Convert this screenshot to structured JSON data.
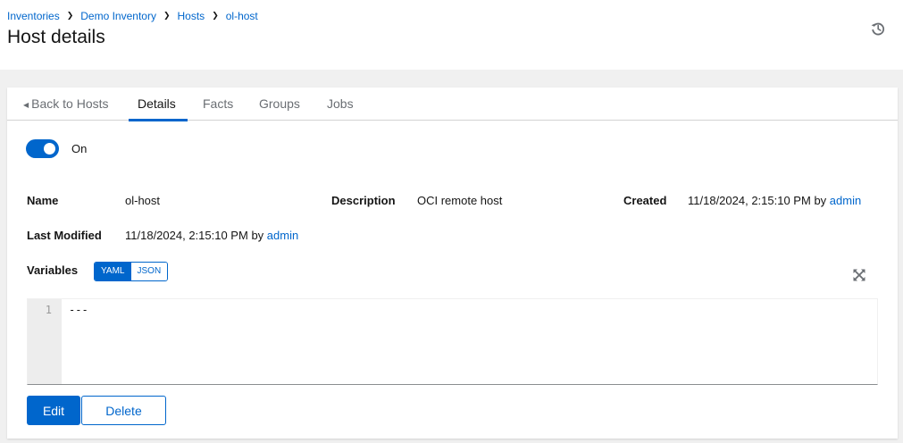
{
  "breadcrumb": [
    {
      "label": "Inventories"
    },
    {
      "label": "Demo Inventory"
    },
    {
      "label": "Hosts"
    },
    {
      "label": "ol-host"
    }
  ],
  "header": {
    "title": "Host details",
    "history_icon": "history-icon"
  },
  "tabs": [
    {
      "label": "Back to Hosts",
      "icon": "caret-left-icon"
    },
    {
      "label": "Details",
      "active": true
    },
    {
      "label": "Facts"
    },
    {
      "label": "Groups"
    },
    {
      "label": "Jobs"
    }
  ],
  "toggle": {
    "label": "On",
    "state": true
  },
  "details": {
    "name_label": "Name",
    "name_value": "ol-host",
    "description_label": "Description",
    "description_value": "OCI remote host",
    "created_label": "Created",
    "created_date": "11/18/2024, 2:15:10 PM",
    "created_by_text": "by",
    "created_user": "admin",
    "modified_label": "Last Modified",
    "modified_date": "11/18/2024, 2:15:10 PM",
    "modified_by_text": "by",
    "modified_user": "admin"
  },
  "variables": {
    "label": "Variables",
    "yaml_label": "YAML",
    "json_label": "JSON",
    "selected": "YAML",
    "line_number": "1",
    "content": "---",
    "expand_icon": "expand-icon"
  },
  "actions": {
    "edit_label": "Edit",
    "delete_label": "Delete"
  },
  "colors": {
    "primary": "#0066cc",
    "text": "#151515",
    "muted": "#6a6e73",
    "background": "#f0f0f0"
  }
}
